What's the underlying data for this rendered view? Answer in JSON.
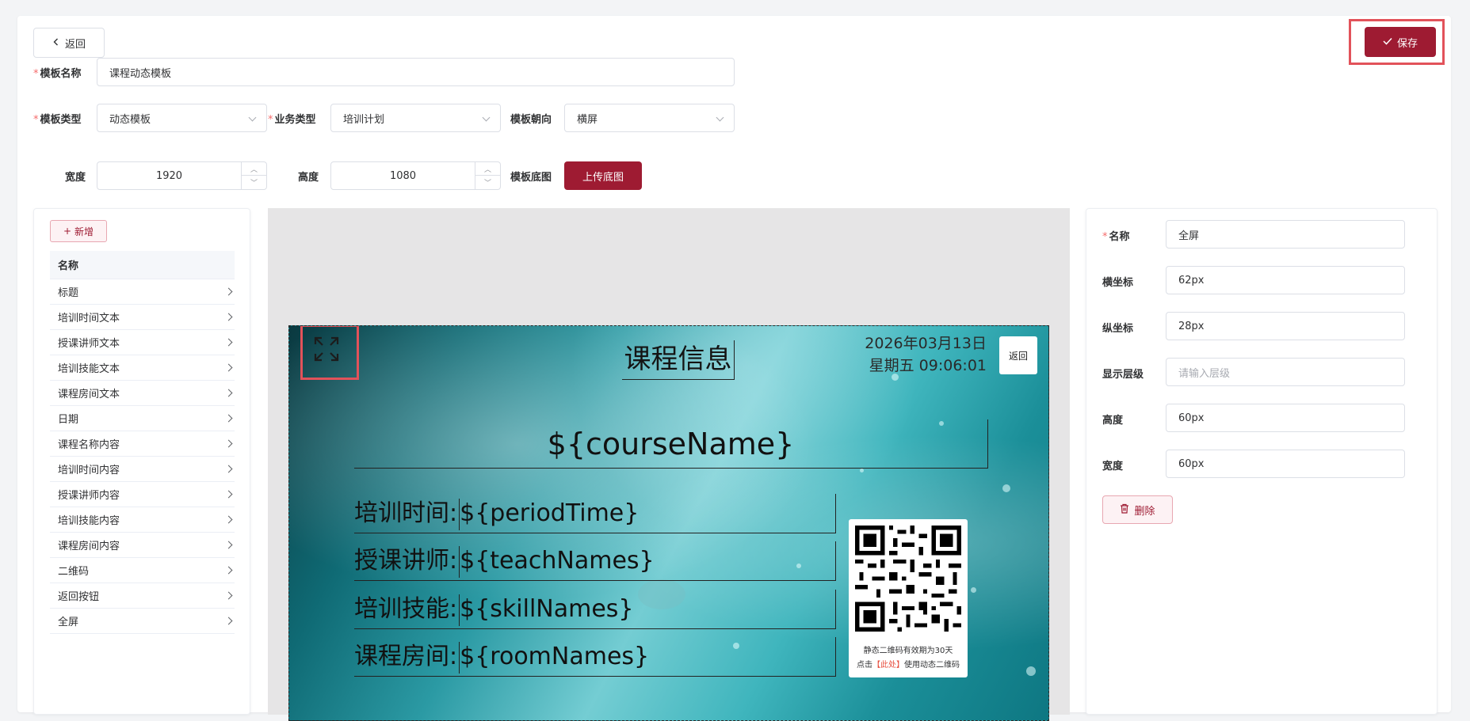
{
  "header": {
    "back_label": "返回",
    "save_label": "保存"
  },
  "form": {
    "name_label": "模板名称",
    "name_value": "课程动态模板",
    "type_label": "模板类型",
    "type_value": "动态模板",
    "biz_label": "业务类型",
    "biz_value": "培训计划",
    "orient_label": "模板朝向",
    "orient_value": "横屏",
    "width_label": "宽度",
    "width_value": "1920",
    "height_label": "高度",
    "height_value": "1080",
    "bg_label": "模板底图",
    "upload_label": "上传底图"
  },
  "sidebar": {
    "add_label": "新增",
    "header": "名称",
    "items": [
      {
        "label": "标题"
      },
      {
        "label": "培训时间文本"
      },
      {
        "label": "授课讲师文本"
      },
      {
        "label": "培训技能文本"
      },
      {
        "label": "课程房间文本"
      },
      {
        "label": "日期"
      },
      {
        "label": "课程名称内容"
      },
      {
        "label": "培训时间内容"
      },
      {
        "label": "授课讲师内容"
      },
      {
        "label": "培训技能内容"
      },
      {
        "label": "课程房间内容"
      },
      {
        "label": "二维码"
      },
      {
        "label": "返回按钮"
      },
      {
        "label": "全屏"
      }
    ]
  },
  "preview": {
    "title": "课程信息",
    "date_line": "2026年03月13日",
    "time_line": "星期五 09:06:01",
    "back_label": "返回",
    "course": "${courseName}",
    "rows": [
      {
        "label": "培训时间:",
        "value": "${periodTime}"
      },
      {
        "label": "授课讲师:",
        "value": "${teachNames}"
      },
      {
        "label": "培训技能:",
        "value": "${skillNames}"
      },
      {
        "label": "课程房间:",
        "value": "${roomNames}"
      }
    ],
    "qr_line1": "静态二维码有效期为30天",
    "qr_line2_pre": "点击",
    "qr_line2_link": "【此处】",
    "qr_line2_post": "使用动态二维码"
  },
  "props": {
    "name_label": "名称",
    "name_value": "全屏",
    "x_label": "横坐标",
    "x_value": "62px",
    "y_label": "纵坐标",
    "y_value": "28px",
    "z_label": "显示层级",
    "z_placeholder": "请输入层级",
    "h_label": "高度",
    "h_value": "60px",
    "w_label": "宽度",
    "w_value": "60px",
    "delete_label": "删除"
  },
  "colors": {
    "primary": "#9e1b32",
    "highlight_border": "#e2525a",
    "required": "#f56c6c"
  }
}
